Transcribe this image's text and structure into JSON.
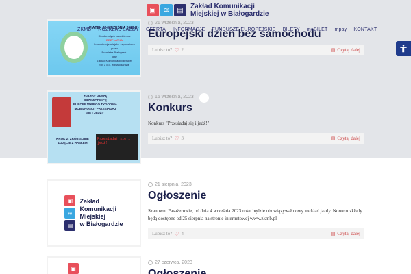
{
  "header": {
    "logo_lines": [
      "Zakład Komunikacji",
      "Miejskiej w Białogardzie"
    ],
    "nav": [
      "ZKMB",
      "ROZKŁAD JAZDY",
      "OFERTA",
      "INFORMACJE",
      "FUNDUSZE EUROPEJSKIE",
      "BILETY",
      "moBILET",
      "mpay",
      "KONTAKT"
    ]
  },
  "accessibility_icon": "accessibility-icon",
  "posts": [
    {
      "date": "21 września, 2023",
      "title": "Europejski dzień bez samochodu",
      "excerpt": "",
      "likes_label": "Lubisz to?",
      "likes": "2",
      "more": "Czytaj dalej",
      "thumb": {
        "top_label": "PIĄTEK 22 WRZEŚNIA 2023 R.",
        "lines": [
          "Dla dorosłych całodzienna",
          "BEZPŁATNA",
          "komunikacja miejska zapewniona przez",
          "Burmistrz Białogardu",
          "oraz",
          "Zakład Komunikacji Miejskiej",
          "Sp. z o.o. w Białogardzie"
        ]
      }
    },
    {
      "date": "15 września, 2023",
      "title": "Konkurs",
      "excerpt": "Konkurs \"Przesiadaj się i jedź!\"",
      "likes_label": "Lubisz to?",
      "likes": "3",
      "more": "Czytaj dalej",
      "thumb": {
        "top_text": "ZNAJDŹ NASZĄ PRZEWODNICĘ EUROPEJSKIEGO TYGODNIA MOBILNOŚCI \"PRZESIADAJ SIĘ I JEDŹ!\"",
        "bottom_text": "KROK 2: ZRÓB SOBIE ZDJĘCIE Z HASŁEM",
        "screen_text": "Przesiadaj się i jedź!"
      }
    },
    {
      "date": "21 sierpnia, 2023",
      "title": "Ogłoszenie",
      "excerpt": "Szanowni Pasażerowie, od dnia 4 września 2023 roku będzie obowiązywał nowy rozkład jazdy. Nowe rozkłady będą dostępne od 25 sierpnia na stronie internetowej www.zkmb.pl",
      "likes_label": "Lubisz to?",
      "likes": "4",
      "more": "Czytaj dalej",
      "thumb": {
        "brand_lines": [
          "Zakład",
          "Komunikacji",
          "Miejskiej",
          "w Białogardzie"
        ]
      }
    },
    {
      "date": "27 czerwca, 2023",
      "title": "Ogłoszenie",
      "excerpt": "",
      "likes_label": "",
      "likes": "",
      "more": "",
      "thumb": {}
    }
  ]
}
